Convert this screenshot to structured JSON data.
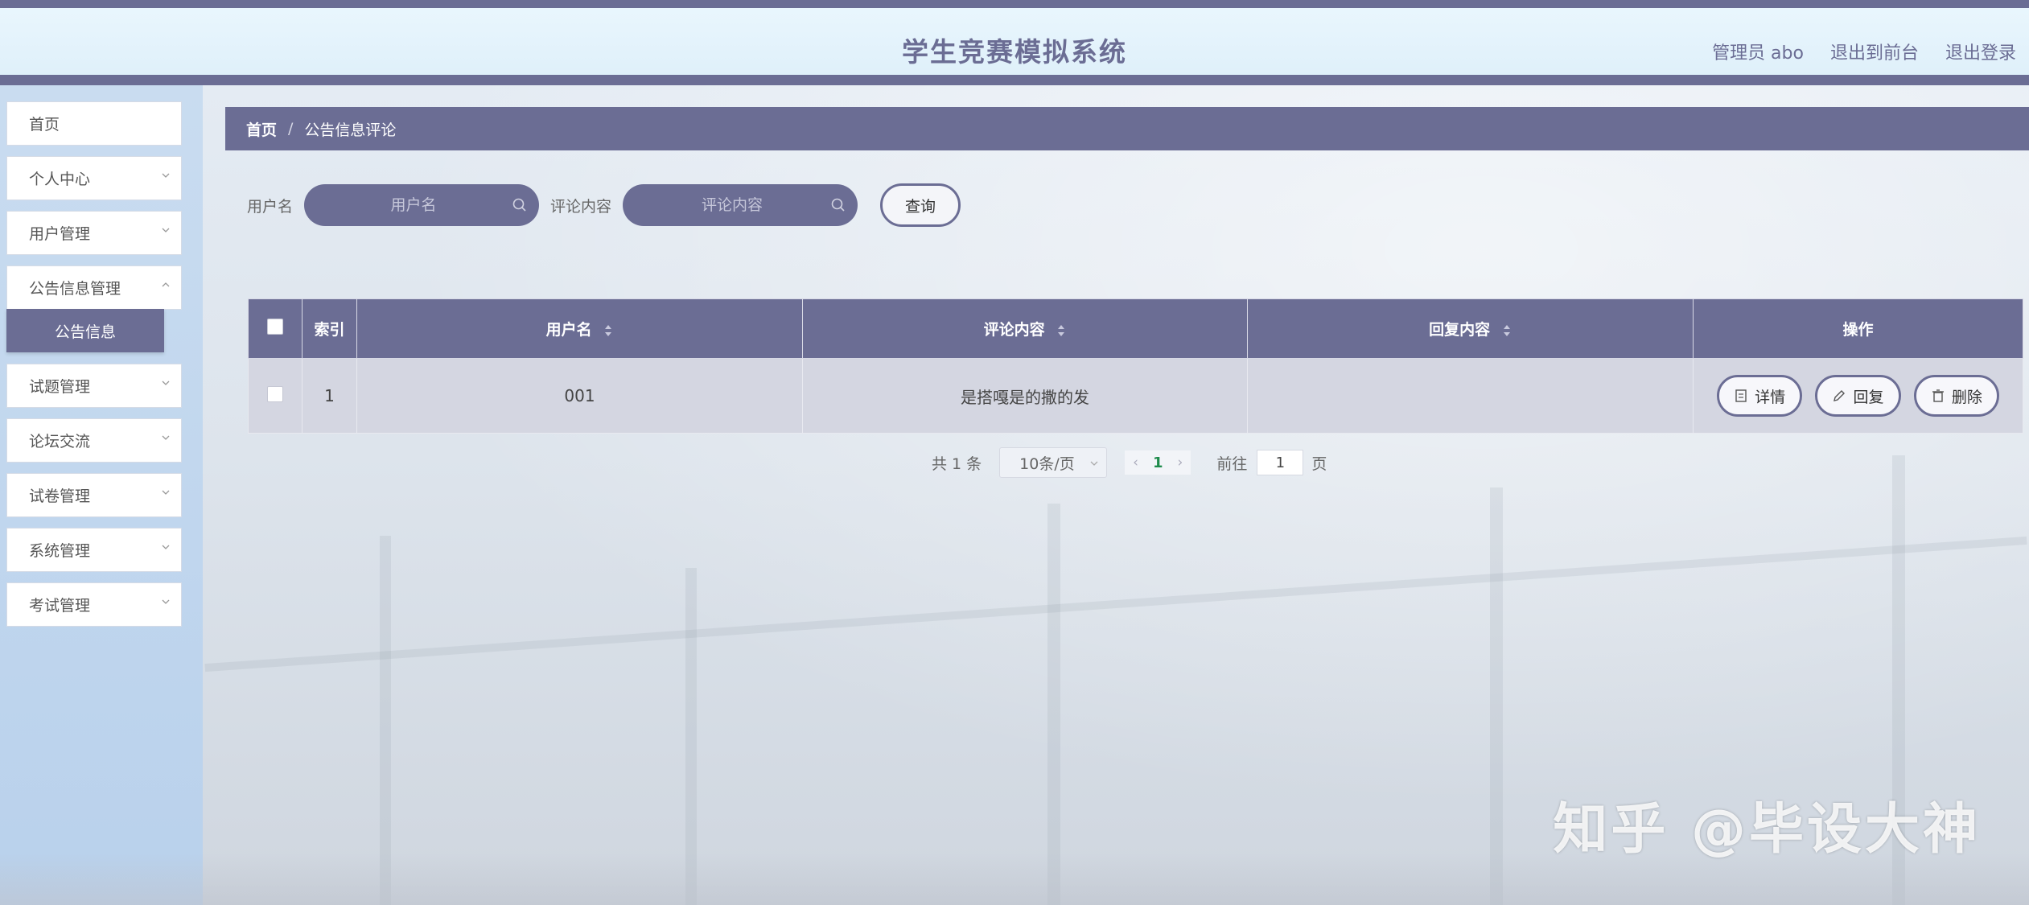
{
  "header": {
    "title": "学生竞赛模拟系统",
    "admin_label": "管理员 abo",
    "to_front_label": "退出到前台",
    "logout_label": "退出登录"
  },
  "sidebar": {
    "items": [
      {
        "label": "首页"
      },
      {
        "label": "个人中心"
      },
      {
        "label": "用户管理"
      },
      {
        "label": "公告信息管理"
      },
      {
        "label": "试题管理"
      },
      {
        "label": "论坛交流"
      },
      {
        "label": "试卷管理"
      },
      {
        "label": "系统管理"
      },
      {
        "label": "考试管理"
      }
    ],
    "active_sub": "公告信息"
  },
  "breadcrumb": {
    "home": "首页",
    "separator": "/",
    "current": "公告信息评论"
  },
  "search": {
    "username_label": "用户名",
    "username_placeholder": "用户名",
    "content_label": "评论内容",
    "content_placeholder": "评论内容",
    "query_button": "查询"
  },
  "table": {
    "headers": {
      "index": "索引",
      "username": "用户名",
      "content": "评论内容",
      "reply": "回复内容",
      "actions": "操作"
    },
    "rows": [
      {
        "index": "1",
        "username": "001",
        "content": "是搭嘎是的撒的发",
        "reply": ""
      }
    ],
    "action_labels": {
      "detail": "详情",
      "reply": "回复",
      "delete": "删除"
    }
  },
  "pagination": {
    "total": "共 1 条",
    "page_size": "10条/页",
    "current_page": "1",
    "goto_prefix": "前往",
    "goto_value": "1",
    "goto_suffix": "页"
  },
  "watermark": "知乎 @毕设大神",
  "colors": {
    "primary": "#6b6d94",
    "header_bg": "#e9f6fd",
    "sidebar_bg": "#c9dcf0",
    "row_bg": "#d4d6e1",
    "active_page": "#1f8b4c"
  }
}
